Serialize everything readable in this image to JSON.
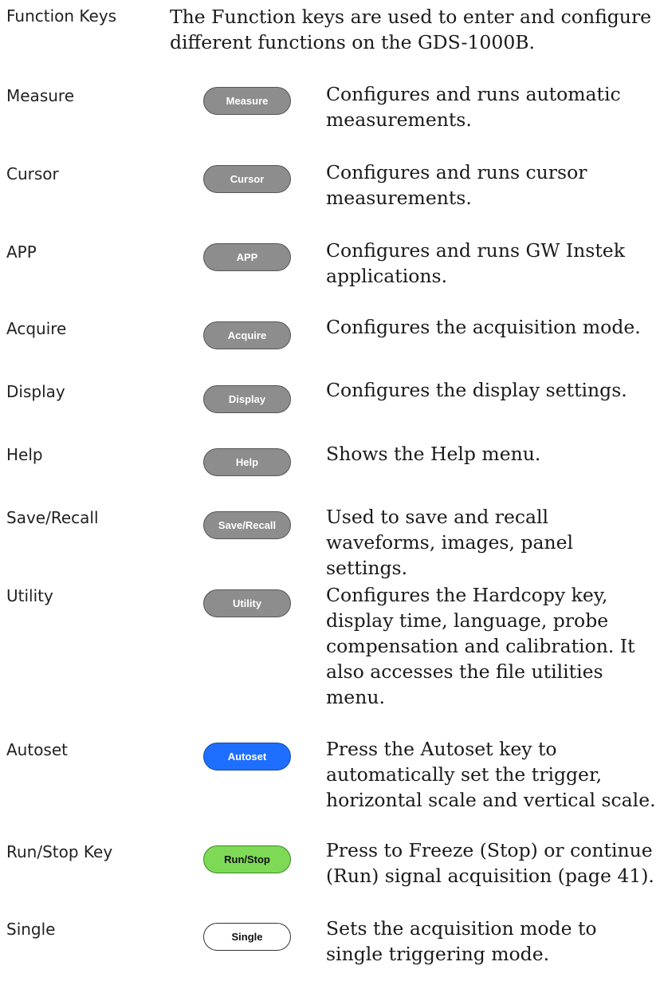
{
  "header": {
    "term": "Function Keys",
    "text": "The Function keys are used to enter and configure different functions on the GDS-1000B."
  },
  "rows": [
    {
      "term": "Measure",
      "key": "Measure",
      "desc": "Configures and runs automatic measurements."
    },
    {
      "term": "Cursor",
      "key": "Cursor",
      "desc": "Configures and runs cursor measurements."
    },
    {
      "term": "APP",
      "key": "APP",
      "desc": "Configures and runs GW Instek applications."
    },
    {
      "term": "Acquire",
      "key": "Acquire",
      "desc": "Configures the acquisition mode."
    },
    {
      "term": "Display",
      "key": "Display",
      "desc": "Configures the display settings."
    },
    {
      "term": "Help",
      "key": "Help",
      "desc": "Shows the Help menu."
    },
    {
      "term": "Save/Recall",
      "key": "Save/Recall",
      "desc": "Used to save and recall waveforms, images, panel settings."
    },
    {
      "term": "Utility",
      "key": "Utility",
      "desc": "Configures the Hardcopy key, display time, language, probe compensation and calibration.  It also accesses the file utilities menu."
    },
    {
      "term": "Autoset",
      "key": "Autoset",
      "desc": "Press the Autoset key to automatically set the trigger, horizontal scale and vertical scale."
    },
    {
      "term": "Run/Stop Key",
      "key": "Run/Stop",
      "desc": "Press to Freeze (Stop) or continue (Run) signal acquisition (page 41)."
    },
    {
      "term": "Single",
      "key": "Single",
      "desc": "Sets the acquisition mode to single triggering mode."
    }
  ],
  "key_colors": {
    "default": "#8d8d8d",
    "autoset": "#1e6fff",
    "run_stop": "#7ed957",
    "single": "#ffffff"
  }
}
